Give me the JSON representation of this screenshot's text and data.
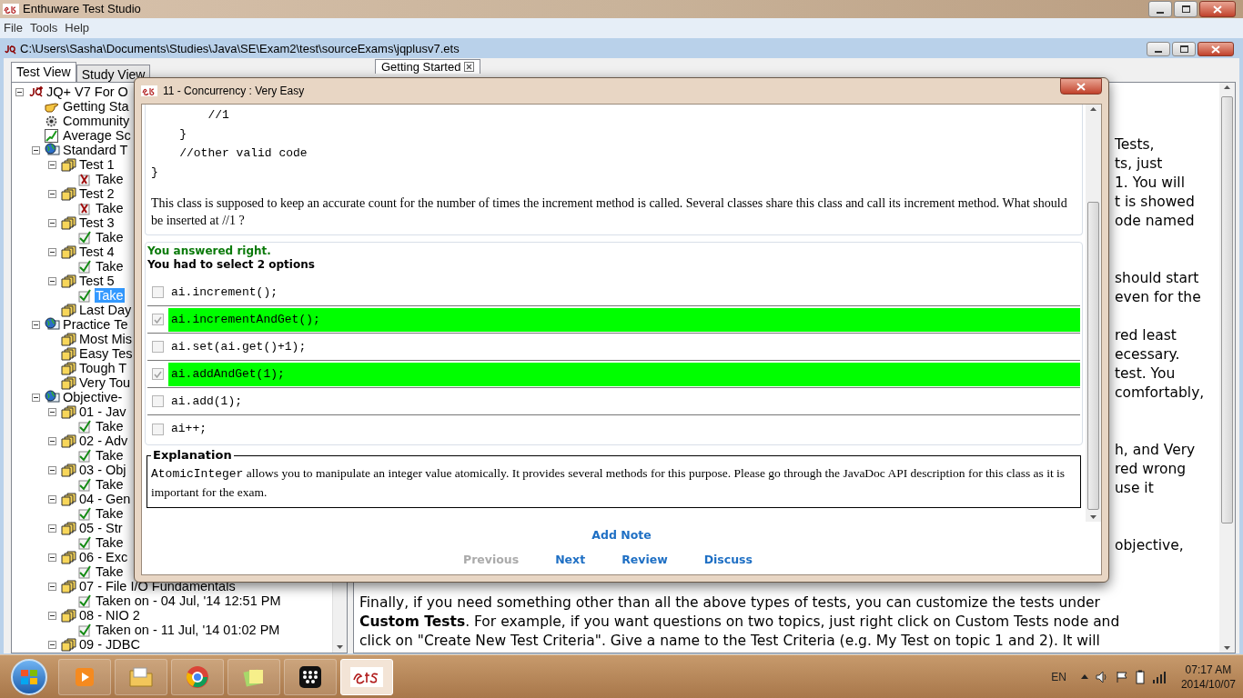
{
  "window": {
    "title": "Enthuware Test Studio"
  },
  "menu": [
    "File",
    "Tools",
    "Help"
  ],
  "document": {
    "path": "C:\\Users\\Sasha\\Documents\\Studies\\Java\\SE\\Exam2\\test\\sourceExams\\jqplusv7.ets"
  },
  "left_tabs": [
    {
      "label": "Test View",
      "selected": true
    },
    {
      "label": "Study View",
      "selected": false
    }
  ],
  "tree": [
    {
      "label": "JQ+ V7 For O",
      "kind": "root",
      "selected": false,
      "expanded": true,
      "children": [
        {
          "label": "Getting Sta",
          "kind": "hand",
          "selected": false
        },
        {
          "label": "Community",
          "kind": "community",
          "selected": false
        },
        {
          "label": "Average Sc",
          "kind": "chart",
          "selected": false
        },
        {
          "label": "Standard T",
          "kind": "globe",
          "selected": false,
          "expanded": true,
          "children": [
            {
              "label": "Test 1",
              "kind": "folder",
              "selected": false,
              "expanded": true,
              "children": [
                {
                  "label": "Take",
                  "kind": "fail",
                  "selected": false
                }
              ]
            },
            {
              "label": "Test 2",
              "kind": "folder",
              "selected": false,
              "expanded": true,
              "children": [
                {
                  "label": "Take",
                  "kind": "fail",
                  "selected": false
                }
              ]
            },
            {
              "label": "Test 3",
              "kind": "folder",
              "selected": false,
              "expanded": true,
              "children": [
                {
                  "label": "Take",
                  "kind": "pass",
                  "selected": false
                }
              ]
            },
            {
              "label": "Test 4",
              "kind": "folder",
              "selected": false,
              "expanded": true,
              "children": [
                {
                  "label": "Take",
                  "kind": "pass",
                  "selected": false
                }
              ]
            },
            {
              "label": "Test 5",
              "kind": "folder",
              "selected": false,
              "expanded": true,
              "children": [
                {
                  "label": "Take",
                  "kind": "pass",
                  "selected": true
                }
              ]
            },
            {
              "label": "Last Day",
              "kind": "folder",
              "selected": false
            }
          ]
        },
        {
          "label": "Practice Te",
          "kind": "globe",
          "selected": false,
          "expanded": true,
          "children": [
            {
              "label": "Most Mis",
              "kind": "folder",
              "selected": false
            },
            {
              "label": "Easy Tes",
              "kind": "folder",
              "selected": false
            },
            {
              "label": "Tough T",
              "kind": "folder",
              "selected": false
            },
            {
              "label": "Very Tou",
              "kind": "folder",
              "selected": false
            }
          ]
        },
        {
          "label": "Objective-",
          "kind": "globe",
          "selected": false,
          "expanded": true,
          "children": [
            {
              "label": "01 - Jav",
              "kind": "folder",
              "selected": false,
              "expanded": true,
              "children": [
                {
                  "label": "Take",
                  "kind": "pass",
                  "selected": false
                }
              ]
            },
            {
              "label": "02 - Adv",
              "kind": "folder",
              "selected": false,
              "expanded": true,
              "children": [
                {
                  "label": "Take",
                  "kind": "pass",
                  "selected": false
                }
              ]
            },
            {
              "label": "03 - Obj",
              "kind": "folder",
              "selected": false,
              "expanded": true,
              "children": [
                {
                  "label": "Take",
                  "kind": "pass",
                  "selected": false
                }
              ]
            },
            {
              "label": "04 - Gen",
              "kind": "folder",
              "selected": false,
              "expanded": true,
              "children": [
                {
                  "label": "Take",
                  "kind": "pass",
                  "selected": false
                }
              ]
            },
            {
              "label": "05 - Str",
              "kind": "folder",
              "selected": false,
              "expanded": true,
              "children": [
                {
                  "label": "Take",
                  "kind": "pass",
                  "selected": false
                }
              ]
            },
            {
              "label": "06 - Exc",
              "kind": "folder",
              "selected": false,
              "expanded": true,
              "children": [
                {
                  "label": "Take",
                  "kind": "pass",
                  "selected": false
                }
              ]
            },
            {
              "label": "07 - File I/O Fundamentals",
              "kind": "folder",
              "selected": false,
              "expanded": true,
              "children": [
                {
                  "label": "Taken on - 04 Jul, '14 12:51 PM",
                  "kind": "pass",
                  "selected": false
                }
              ]
            },
            {
              "label": "08 - NIO 2",
              "kind": "folder",
              "selected": false,
              "expanded": true,
              "children": [
                {
                  "label": "Taken on - 11 Jul, '14 01:02 PM",
                  "kind": "pass",
                  "selected": false
                }
              ]
            },
            {
              "label": "09 - JDBC",
              "kind": "folder",
              "selected": false,
              "expanded": true
            }
          ]
        }
      ]
    }
  ],
  "right_tabs": [
    {
      "label": "Getting Started",
      "selected": true
    }
  ],
  "content": {
    "fragments": [
      {
        "lines": [
          "Tests,",
          "ts, just",
          "1. You will",
          "t is showed",
          "ode named"
        ]
      },
      {
        "lines": [
          "should start",
          "even for the"
        ]
      },
      {
        "lines": [
          "red least",
          "ecessary.",
          "test. You",
          "comfortably,"
        ]
      },
      {
        "lines": [
          "h, and Very",
          "red wrong",
          "use it"
        ]
      },
      {
        "lines": [
          "objective,"
        ]
      }
    ],
    "closing": {
      "lines": [
        "Finally, if you need something other than all the above types of tests, you can customize the tests under",
        "**Custom Tests**. For example, if you want questions on two topics, just right click on Custom Tests node and",
        "click on \"Create New Test Criteria\".  Give a name to the Test Criteria (e.g. My Test on topic 1 and 2). It will"
      ]
    }
  },
  "dialog": {
    "title": "11 - Concurrency : Very Easy",
    "code": [
      "        //1",
      "    }",
      "    //other valid code",
      "}"
    ],
    "question": "This class is supposed to keep an accurate count for the number of times the increment method is called. Several classes share this class and call its increment method. What should be inserted at //1 ?",
    "result": "You answered right.",
    "instruction": "You had to select 2 options",
    "options": [
      {
        "text": "ai.increment();",
        "checked": false,
        "highlighted": false
      },
      {
        "text": "ai.incrementAndGet();",
        "checked": true,
        "highlighted": true
      },
      {
        "text": "ai.set(ai.get()+1);",
        "checked": false,
        "highlighted": false
      },
      {
        "text": "ai.addAndGet(1);",
        "checked": true,
        "highlighted": true
      },
      {
        "text": "ai.add(1);",
        "checked": false,
        "highlighted": false
      },
      {
        "text": "ai++;",
        "checked": false,
        "highlighted": false
      }
    ],
    "explanation": {
      "title": "Explanation",
      "term": "AtomicInteger",
      "text": "allows you to manipulate an integer value atomically. It provides several methods for this purpose. Please go through the JavaDoc API description for this class as it is important for the exam."
    },
    "add_note": "Add Note",
    "nav": [
      {
        "label": "Previous",
        "disabled": true
      },
      {
        "label": "Next",
        "disabled": false
      },
      {
        "label": "Review",
        "disabled": false
      },
      {
        "label": "Discuss",
        "disabled": false
      }
    ]
  },
  "taskbar": {
    "apps": [
      {
        "kind": "media",
        "active": false
      },
      {
        "kind": "folders",
        "active": false
      },
      {
        "kind": "browser",
        "active": false
      },
      {
        "kind": "notes",
        "active": false
      },
      {
        "kind": "dots",
        "active": false
      },
      {
        "kind": "ets",
        "active": true
      }
    ],
    "language": "EN",
    "time": "07:17 AM",
    "date": "2014/10/07"
  }
}
